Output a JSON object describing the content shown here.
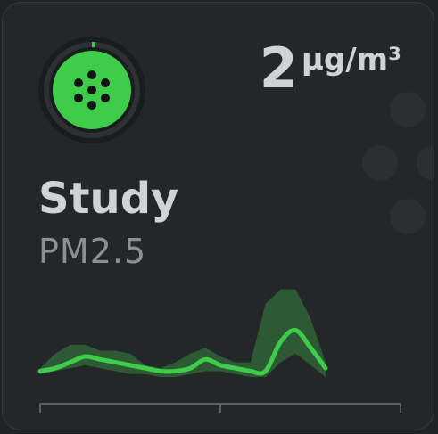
{
  "card": {
    "name": "Study",
    "subtitle": "PM2.5",
    "value": "2",
    "unit": "µg/m³",
    "icon": "air-quality-sensor-icon",
    "accent_color": "#3ecc4a",
    "band_color": "#2f5f35"
  },
  "chart_data": {
    "type": "line",
    "series": [
      {
        "values": [
          2,
          3,
          5,
          7,
          6,
          5,
          4,
          3,
          2,
          2,
          3,
          6,
          4,
          3,
          2,
          2,
          12,
          16,
          10,
          3
        ]
      }
    ],
    "band_upper": [
      3,
      8,
      11,
      11,
      9,
      9,
      8,
      4,
      3,
      5,
      8,
      10,
      7,
      5,
      5,
      25,
      30,
      30,
      20,
      5
    ],
    "band_lower": [
      1,
      2,
      3,
      4,
      3,
      2,
      1,
      1,
      0,
      0,
      1,
      2,
      2,
      1,
      0,
      0,
      5,
      8,
      4,
      0
    ],
    "ylim": [
      0,
      32
    ],
    "grid": false
  }
}
